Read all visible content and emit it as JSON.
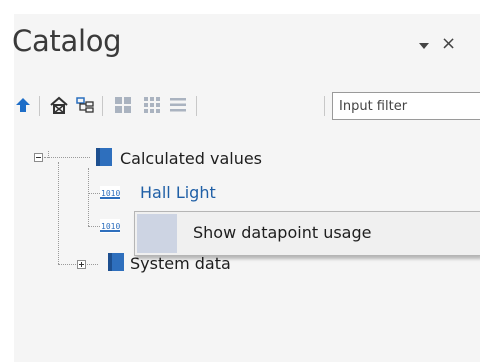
{
  "panel": {
    "title": "Catalog",
    "close_glyph": "×"
  },
  "toolbar": {
    "buttons": [
      {
        "name": "navigate-up-icon"
      },
      {
        "name": "building-icon"
      },
      {
        "name": "hierarchy-icon"
      },
      {
        "name": "large-tiles-icon"
      },
      {
        "name": "small-tiles-icon"
      },
      {
        "name": "list-view-icon"
      }
    ],
    "filter_placeholder": "Input filter"
  },
  "tree": {
    "nodes": [
      {
        "label": "Calculated values",
        "expanded": true,
        "icon": "folder-icon"
      },
      {
        "label": "Hall Light",
        "selected": true,
        "icon": "datapoint-icon"
      },
      {
        "label": "",
        "icon": "datapoint-icon"
      },
      {
        "label": "System data",
        "expanded": false,
        "icon": "folder-icon"
      }
    ]
  },
  "context_menu": {
    "items": [
      {
        "label": "Show datapoint usage"
      }
    ]
  },
  "colors": {
    "panel_bg": "#f5f5f5",
    "selected_text": "#1f5fa6",
    "icon_blue": "#2e6fbd",
    "menu_icon_col": "#cdd4e3"
  }
}
